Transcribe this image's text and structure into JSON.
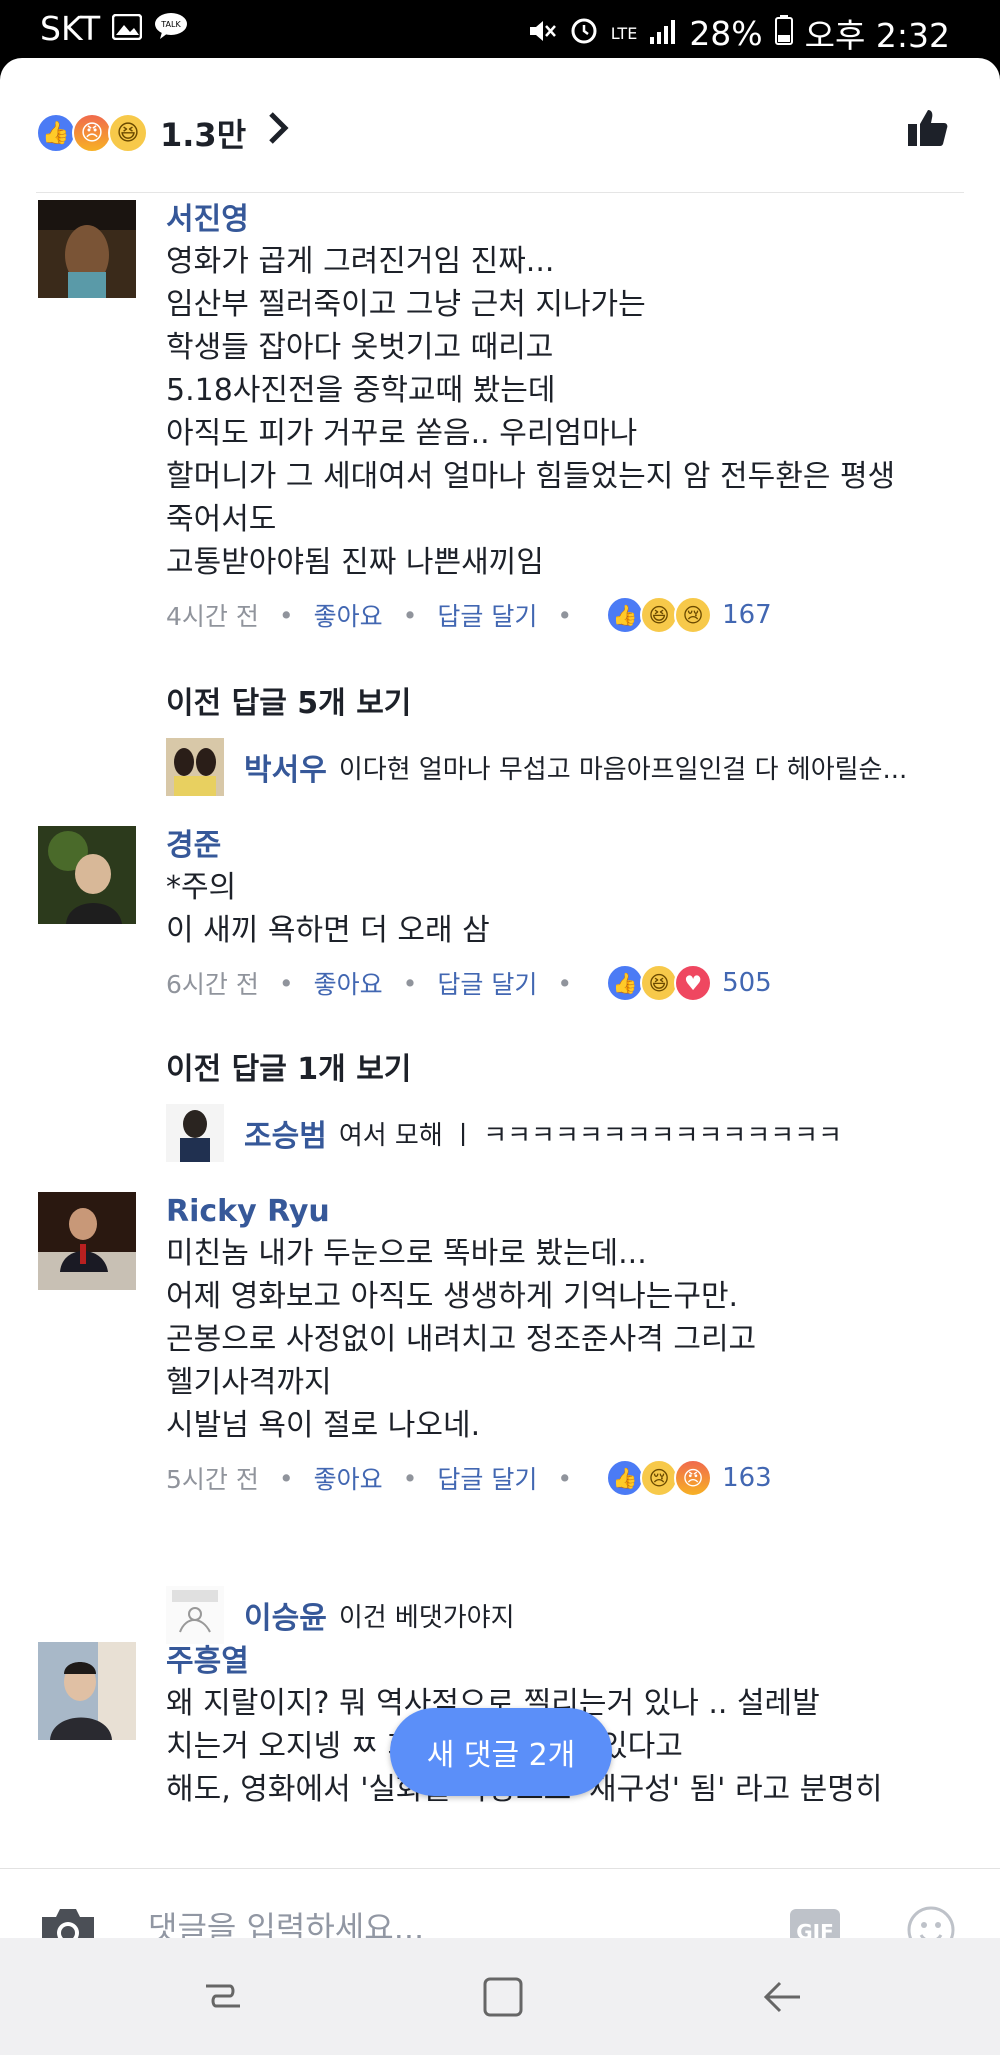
{
  "status_bar": {
    "carrier": "SKT",
    "lte": "LTE",
    "battery": "28%",
    "time": "오후 2:32"
  },
  "reactions_header": {
    "icons": [
      "like",
      "angry",
      "haha"
    ],
    "count": "1.3만"
  },
  "comments": [
    {
      "name": "서진영",
      "text": "영화가 곱게 그려진거임 진짜...\n임산부 찔러죽이고 그냥 근처 지나가는\n학생들 잡아다 옷벗기고 때리고\n5.18사진전을 중학교때 봤는데\n아직도 피가 거꾸로 쏟음.. 우리엄마나\n할머니가 그 세대여서 얼마나 힘들었는지 암 전두환은 평생\n죽어서도\n고통받아야됨 진짜 나쁜새끼임",
      "time": "4시간 전",
      "like": "좋아요",
      "reply": "답글 달기",
      "reactions": [
        "like",
        "haha",
        "sad"
      ],
      "reaction_count": "167"
    },
    {
      "name": "경준",
      "text": "*주의\n이 새끼 욕하면 더 오래 삼",
      "time": "6시간 전",
      "like": "좋아요",
      "reply": "답글 달기",
      "reactions": [
        "like",
        "haha",
        "love"
      ],
      "reaction_count": "505"
    },
    {
      "name": "Ricky Ryu",
      "text": "미친놈 내가 두눈으로 똑바로 봤는데...\n어제 영화보고 아직도 생생하게 기억나는구만.\n곤봉으로 사정없이 내려치고 정조준사격 그리고\n헬기사격까지\n시발넘 욕이 절로 나오네.",
      "time": "5시간 전",
      "like": "좋아요",
      "reply": "답글 달기",
      "reactions": [
        "like",
        "sad",
        "angry"
      ],
      "reaction_count": "163"
    },
    {
      "name": "주흥열",
      "text": "왜 지랄이지? 뭐 역사적으로 찔리는거 있나 .. 설레발\n치는거 오지넹 ㅉ                화에서 왜곡된게 있다고\n해도, 영화에서 '실화를 바탕으로 '재구성' 됨' 라고 분명히"
    }
  ],
  "previous_replies": [
    {
      "label": "이전 답글 5개 보기"
    },
    {
      "label": "이전 답글 1개 보기"
    }
  ],
  "replies": [
    {
      "name": "박서우",
      "text": "이다현 얼마나 무섭고 마음아프일인걸 다 헤아릴순..."
    },
    {
      "name": "조승범",
      "text": "여서 모해 ㅣ ㅋㅋㅋㅋㅋㅋㅋㅋㅋㅋㅋㅋㅋㅋㅋ"
    },
    {
      "name": "이승윤",
      "text": "이건 베댓가야지"
    }
  ],
  "new_comments_pill": "새 댓글 2개",
  "composer": {
    "placeholder": "댓글을 입력하세요...",
    "gif_label": "GIF"
  },
  "colors": {
    "like_blue": "#4b7bf5",
    "link_blue": "#4267b2",
    "name_blue": "#365899",
    "pill_blue": "#5b8ff9"
  }
}
